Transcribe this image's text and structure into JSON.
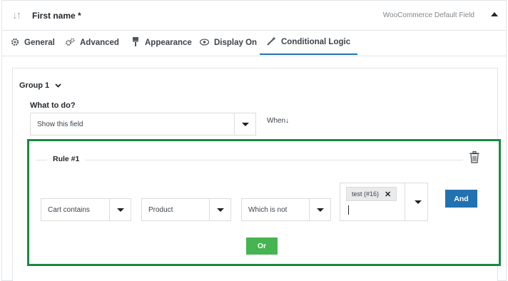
{
  "header": {
    "sort_icon": "sort-arrows-icon",
    "title": "First name *",
    "field_type": "WooCommerce Default Field",
    "collapse_icon": "caret-up-icon"
  },
  "tabs": [
    {
      "label": "General",
      "icon": "gear-icon"
    },
    {
      "label": "Advanced",
      "icon": "gears-icon"
    },
    {
      "label": "Appearance",
      "icon": "paint-brush-icon"
    },
    {
      "label": "Display On",
      "icon": "eye-icon"
    },
    {
      "label": "Conditional Logic",
      "icon": "magic-wand-icon",
      "active": true
    }
  ],
  "group": {
    "label": "Group 1",
    "what_to_do_label": "What to do?",
    "action_value": "Show this field",
    "when_label": "When"
  },
  "rule": {
    "label": "Rule #1",
    "condition_value": "Cart contains",
    "entity_value": "Product",
    "operator_value": "Which is not",
    "selected_tags": [
      "test (#16)"
    ],
    "and_label": "And",
    "or_label": "Or"
  },
  "colors": {
    "accent": "#2271b1",
    "rule_border": "#1a8a41",
    "or_button": "#46b450"
  }
}
